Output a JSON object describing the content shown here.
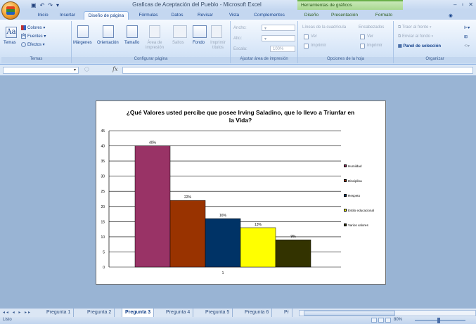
{
  "window": {
    "title": "Graficas de Aceptación del Pueblo - Microsoft Excel",
    "context_title": "Herramientas de gráficos",
    "controls": [
      "–",
      "▫",
      "✕"
    ]
  },
  "tabs": [
    {
      "label": "Inicio"
    },
    {
      "label": "Insertar"
    },
    {
      "label": "Diseño de página"
    },
    {
      "label": "Fórmulas"
    },
    {
      "label": "Datos"
    },
    {
      "label": "Revisar"
    },
    {
      "label": "Vista"
    },
    {
      "label": "Complementos"
    },
    {
      "label": "Diseño"
    },
    {
      "label": "Presentación"
    },
    {
      "label": "Formato"
    }
  ],
  "ribbon": {
    "temas": {
      "temas_label": "Temas",
      "colores": "Colores",
      "fuentes": "Fuentes",
      "efectos": "Efectos",
      "group_label": "Temas"
    },
    "configurar": {
      "margenes": "Márgenes",
      "orientacion": "Orientación",
      "tamano": "Tamaño",
      "area": "Área de impresión",
      "saltos": "Saltos",
      "fondo": "Fondo",
      "imprimir": "Imprimir títulos",
      "group_label": "Configurar página"
    },
    "ajustar": {
      "ancho": "Ancho:",
      "alto": "Alto:",
      "escala": "Escala:",
      "escala_value": "100%",
      "group_label": "Ajustar área de impresión"
    },
    "opciones": {
      "lineas": "Líneas de la cuadrícula",
      "encabezados": "Encabezados",
      "ver1": "Ver",
      "ver2": "Ver",
      "imprimir1": "Imprimir",
      "imprimir2": "Imprimir",
      "group_label": "Opciones de la hoja"
    },
    "organizar": {
      "traer": "Traer al frente",
      "enviar": "Enviar al fondo",
      "panel": "Panel de selección",
      "group_label": "Organizar"
    }
  },
  "formula_bar": {
    "namebox_value": "▾",
    "fx": "fx"
  },
  "chart_data": {
    "type": "bar",
    "title": "¿Qué Valores usted percibe que posee Irving Saladino, que lo llevo a Triunfar en la Vida?",
    "categories": [
      "1"
    ],
    "ylim": [
      0,
      45
    ],
    "yticks": [
      "0",
      "5",
      "10",
      "15",
      "20",
      "25",
      "30",
      "35",
      "40",
      "45"
    ],
    "grid": true,
    "legend_position": "right",
    "series": [
      {
        "name": "Humildad",
        "values": [
          40
        ],
        "label": "40%",
        "color": "#993366"
      },
      {
        "name": "Disciplina",
        "values": [
          22
        ],
        "label": "22%",
        "color": "#993300"
      },
      {
        "name": "Respeto",
        "values": [
          16
        ],
        "label": "16%",
        "color": "#003366"
      },
      {
        "name": "Estilo educacional",
        "values": [
          13
        ],
        "label": "13%",
        "color": "#ffff00"
      },
      {
        "name": "Varios valores",
        "values": [
          9
        ],
        "label": "9%",
        "color": "#333300"
      }
    ]
  },
  "sheets": {
    "tabs": [
      "Pregunta 1",
      "Pregunta 2",
      "Pregunta 3",
      "Pregunta 4",
      "Pregunta 5",
      "Pregunta 6",
      "Pr"
    ],
    "active": "Pregunta 3",
    "nav": "◂◂ ◂ ▸ ▸▸"
  },
  "status": {
    "text": "Listo",
    "zoom": "80%"
  }
}
